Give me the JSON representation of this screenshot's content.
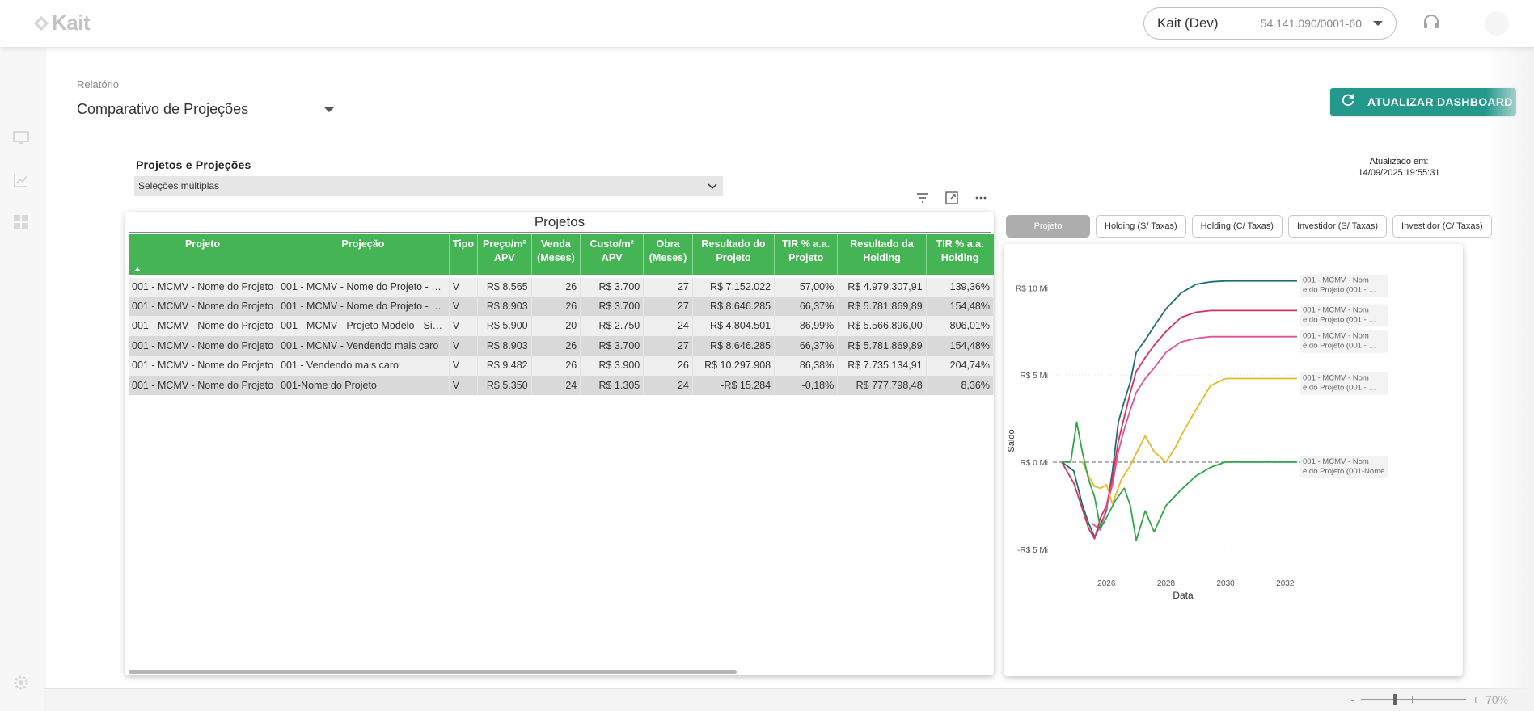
{
  "app": {
    "logo_text": "Kait",
    "company_name": "Kait (Dev)",
    "company_cnpj": "54.141.090/0001-60"
  },
  "report": {
    "label": "Relatório",
    "value": "Comparativo de Projeções"
  },
  "refresh_button": "ATUALIZAR DASHBOARD",
  "slicer": {
    "title": "Projetos e Projeções",
    "value": "Seleções múltiplas"
  },
  "updated": {
    "label": "Atualizado em:",
    "datetime": "14/09/2025 19:55:31"
  },
  "table": {
    "title": "Projetos",
    "headers": [
      [
        "Projeto"
      ],
      [
        "Projeção"
      ],
      [
        "Tipo"
      ],
      [
        "Preço/m²",
        "APV"
      ],
      [
        "Venda",
        "(Meses)"
      ],
      [
        "Custo/m²",
        "APV"
      ],
      [
        "Obra",
        "(Meses)"
      ],
      [
        "Resultado do",
        "Projeto"
      ],
      [
        "TIR % a.a.",
        "Projeto"
      ],
      [
        "Resultado da",
        "Holding"
      ],
      [
        "TIR % a.a.",
        "Holding"
      ]
    ],
    "rows": [
      [
        "001 - MCMV - Nome do Projeto",
        "001 - MCMV - Nome do Projeto - …",
        "V",
        "R$ 8.565",
        "26",
        "R$ 3.700",
        "27",
        "R$ 7.152.022",
        "57,00%",
        "R$ 4.979.307,91",
        "139,36%"
      ],
      [
        "001 - MCMV - Nome do Projeto",
        "001 - MCMV - Nome do Projeto - …",
        "V",
        "R$ 8.903",
        "26",
        "R$ 3.700",
        "27",
        "R$ 8.646.285",
        "66,37%",
        "R$ 5.781.869,89",
        "154,48%"
      ],
      [
        "001 - MCMV - Nome do Projeto",
        "001 - MCMV - Projeto Modelo - Si…",
        "V",
        "R$ 5.900",
        "20",
        "R$ 2.750",
        "24",
        "R$ 4.804.501",
        "86,99%",
        "R$ 5.566.896,00",
        "806,01%"
      ],
      [
        "001 - MCMV - Nome do Projeto",
        "001 - MCMV - Vendendo mais caro",
        "V",
        "R$ 8.903",
        "26",
        "R$ 3.700",
        "27",
        "R$ 8.646.285",
        "66,37%",
        "R$ 5.781.869,89",
        "154,48%"
      ],
      [
        "001 - MCMV - Nome do Projeto",
        "001 - Vendendo mais caro",
        "V",
        "R$ 9.482",
        "26",
        "R$ 3.900",
        "26",
        "R$ 10.297.908",
        "86,38%",
        "R$ 7.735.134,91",
        "204,74%"
      ],
      [
        "001 - MCMV - Nome do Projeto",
        "001-Nome do Projeto",
        "V",
        "R$ 5.350",
        "24",
        "R$ 1.305",
        "24",
        "-R$ 15.284",
        "-0,18%",
        "R$ 777.798,48",
        "8,36%"
      ]
    ]
  },
  "tabs": [
    {
      "label": "Projeto",
      "active": true
    },
    {
      "label": "Holding (S/ Taxas)",
      "active": false
    },
    {
      "label": "Holding (C/ Taxas)",
      "active": false
    },
    {
      "label": "Investidor (S/ Taxas)",
      "active": false
    },
    {
      "label": "Investidor (C/ Taxas)",
      "active": false
    }
  ],
  "chart_data": {
    "type": "line",
    "xlabel": "Data",
    "ylabel": "Saldo",
    "x_ticks": [
      "2026",
      "2028",
      "2030",
      "2032"
    ],
    "y_ticks": [
      "R$ 10 Mi",
      "R$ 5 Mi",
      "R$ 0 Mi",
      "-R$ 5 Mi"
    ],
    "xlim": [
      2024.2,
      2032.4
    ],
    "ylim": [
      -5.8,
      11.5
    ],
    "zero_line": true,
    "series": [
      {
        "name": "001 - MCMV - Nome do Projeto (001 - …",
        "color": "#1f6d7a",
        "x": [
          2024.5,
          2024.9,
          2025.2,
          2025.4,
          2025.6,
          2025.8,
          2026.0,
          2026.2,
          2026.4,
          2026.6,
          2026.8,
          2027.0,
          2027.3,
          2027.6,
          2028.0,
          2028.5,
          2029.0,
          2029.5,
          2030.0,
          2031.0,
          2032.4
        ],
        "y": [
          0,
          -0.5,
          -2.5,
          -3.5,
          -4.3,
          -3.6,
          -2.8,
          -0.5,
          2.3,
          3.5,
          4.6,
          6.3,
          7.0,
          7.8,
          8.8,
          9.7,
          10.2,
          10.35,
          10.4,
          10.4,
          10.4
        ]
      },
      {
        "name": "001 - MCMV - Nome do Projeto (001 - …",
        "color": "#d6335c",
        "x": [
          2024.5,
          2024.9,
          2025.1,
          2025.4,
          2025.6,
          2025.8,
          2026.0,
          2026.2,
          2026.4,
          2026.6,
          2026.8,
          2027.0,
          2027.3,
          2027.6,
          2028.0,
          2028.5,
          2029.0,
          2029.5,
          2030.0,
          2031.0,
          2032.4
        ],
        "y": [
          0,
          -1.2,
          -2.2,
          -3.8,
          -4.4,
          -3.2,
          -2.5,
          -0.9,
          1.2,
          2.6,
          4.0,
          5.2,
          6.0,
          6.7,
          7.5,
          8.3,
          8.6,
          8.7,
          8.7,
          8.7,
          8.7
        ]
      },
      {
        "name": "001 - MCMV - Nome do Projeto (001 - …",
        "color": "#e0529c",
        "x": [
          2025.5,
          2025.8,
          2026.0,
          2026.2,
          2026.4,
          2026.6,
          2026.8,
          2027.0,
          2027.3,
          2027.6,
          2028.0,
          2028.5,
          2029.0,
          2029.5,
          2030.0,
          2031.0,
          2032.4
        ],
        "y": [
          -3.5,
          -3.9,
          -2.6,
          -1.3,
          0.6,
          1.9,
          3.0,
          4.0,
          4.8,
          5.4,
          6.3,
          6.9,
          7.1,
          7.2,
          7.2,
          7.2,
          7.2
        ]
      },
      {
        "name": "001 - MCMV - Nome do Projeto (001 - …",
        "color": "#e8b82a",
        "x": [
          2025.2,
          2025.4,
          2025.6,
          2025.8,
          2026.0,
          2026.2,
          2026.5,
          2026.8,
          2027.0,
          2027.3,
          2027.6,
          2028.0,
          2028.3,
          2028.6,
          2029.0,
          2029.5,
          2030.0,
          2031.0,
          2032.4
        ],
        "y": [
          0,
          -0.8,
          -1.4,
          -1.5,
          -1.3,
          -2.4,
          -1.0,
          -0.2,
          0.5,
          1.5,
          0.6,
          0,
          0.8,
          1.8,
          3.0,
          4.4,
          4.8,
          4.8,
          4.8
        ]
      },
      {
        "name": "001 - MCMV - Nome do Projeto (001-Nome …",
        "color": "#2ea84a",
        "x": [
          2024.5,
          2024.8,
          2025.0,
          2025.2,
          2025.4,
          2025.6,
          2025.8,
          2026.0,
          2026.3,
          2026.6,
          2026.8,
          2027.0,
          2027.3,
          2027.6,
          2028.0,
          2028.5,
          2029.0,
          2029.5,
          2030.0,
          2031.0,
          2032.4
        ],
        "y": [
          0,
          0,
          2.3,
          0.5,
          -1.0,
          -2.0,
          -3.8,
          -3.2,
          -2.2,
          -1.5,
          -2.5,
          -4.5,
          -2.8,
          -4.0,
          -2.5,
          -1.6,
          -0.8,
          -0.3,
          0,
          0,
          0
        ]
      }
    ]
  }
}
